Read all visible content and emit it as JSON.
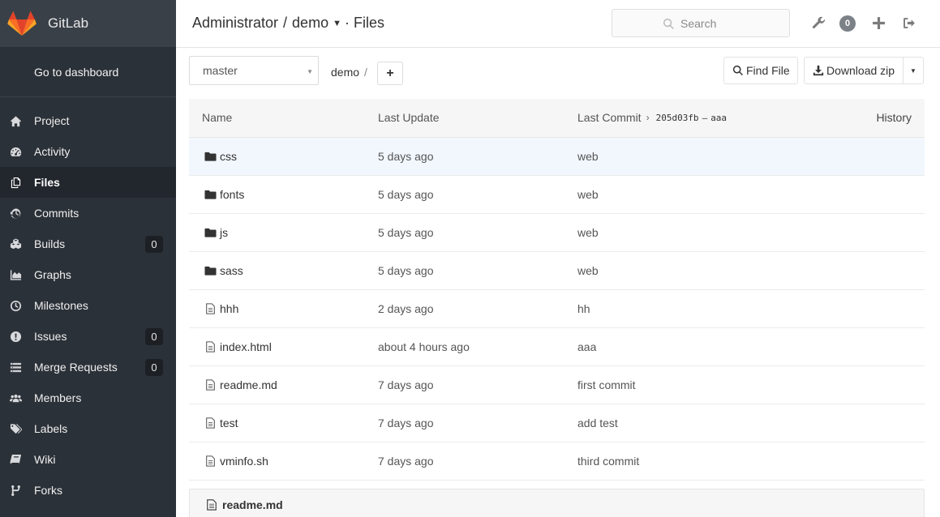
{
  "brand": {
    "name": "GitLab"
  },
  "sidebar": {
    "dashboard_link": "Go to dashboard",
    "items": [
      {
        "label": "Project",
        "icon": "home-icon"
      },
      {
        "label": "Activity",
        "icon": "dashboard-icon"
      },
      {
        "label": "Files",
        "icon": "files-icon",
        "active": true
      },
      {
        "label": "Commits",
        "icon": "history-icon"
      },
      {
        "label": "Builds",
        "icon": "cubes-icon",
        "count": "0"
      },
      {
        "label": "Graphs",
        "icon": "area-chart-icon"
      },
      {
        "label": "Milestones",
        "icon": "clock-icon"
      },
      {
        "label": "Issues",
        "icon": "exclamation-circle-icon",
        "count": "0"
      },
      {
        "label": "Merge Requests",
        "icon": "list-icon",
        "count": "0"
      },
      {
        "label": "Members",
        "icon": "users-icon"
      },
      {
        "label": "Labels",
        "icon": "tags-icon"
      },
      {
        "label": "Wiki",
        "icon": "book-icon"
      },
      {
        "label": "Forks",
        "icon": "fork-icon"
      }
    ]
  },
  "header": {
    "owner": "Administrator",
    "separator": "/",
    "project": "demo",
    "page": "· Files",
    "search_placeholder": "Search",
    "todo_count": "0"
  },
  "toolbar": {
    "branch": "master",
    "path_root": "demo",
    "path_sep": "/",
    "add_label": "+",
    "find_file": "Find File",
    "download_zip": "Download zip"
  },
  "table": {
    "headers": {
      "name": "Name",
      "last_update": "Last Update",
      "last_commit": "Last Commit",
      "commit_sha": "205d03fb",
      "commit_sep": "–",
      "commit_msg": "aaa",
      "history": "History"
    },
    "rows": [
      {
        "type": "folder",
        "name": "css",
        "updated": "5 days ago",
        "message": "web"
      },
      {
        "type": "folder",
        "name": "fonts",
        "updated": "5 days ago",
        "message": "web"
      },
      {
        "type": "folder",
        "name": "js",
        "updated": "5 days ago",
        "message": "web"
      },
      {
        "type": "folder",
        "name": "sass",
        "updated": "5 days ago",
        "message": "web"
      },
      {
        "type": "file",
        "name": "hhh",
        "updated": "2 days ago",
        "message": "hh"
      },
      {
        "type": "file",
        "name": "index.html",
        "updated": "about 4 hours ago",
        "message": "aaa"
      },
      {
        "type": "file",
        "name": "readme.md",
        "updated": "7 days ago",
        "message": "first commit"
      },
      {
        "type": "file",
        "name": "test",
        "updated": "7 days ago",
        "message": "add test"
      },
      {
        "type": "file",
        "name": "vminfo.sh",
        "updated": "7 days ago",
        "message": "third commit"
      }
    ]
  },
  "readme": {
    "title": "readme.md"
  },
  "colors": {
    "sidebar_bg": "#2b3138",
    "brand_bg": "#394048",
    "accent_orange": "#e24329",
    "row_highlight": "#f1f7fd"
  }
}
